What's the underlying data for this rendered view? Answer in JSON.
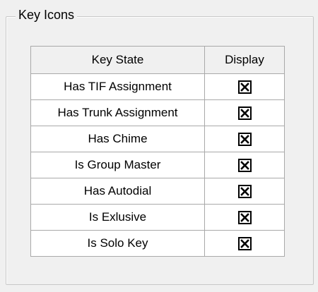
{
  "group": {
    "title": "Key Icons"
  },
  "grid": {
    "columns": [
      "Key State",
      "Display"
    ],
    "rows": [
      {
        "key_state": "Has TIF Assignment",
        "display": true
      },
      {
        "key_state": "Has Trunk Assignment",
        "display": true
      },
      {
        "key_state": "Has Chime",
        "display": true
      },
      {
        "key_state": "Is Group Master",
        "display": true
      },
      {
        "key_state": "Has Autodial",
        "display": true
      },
      {
        "key_state": "Is Exlusive",
        "display": true
      },
      {
        "key_state": "Is Solo Key",
        "display": true
      }
    ]
  },
  "icons": {
    "checkbox_checked": "x-mark-icon"
  }
}
